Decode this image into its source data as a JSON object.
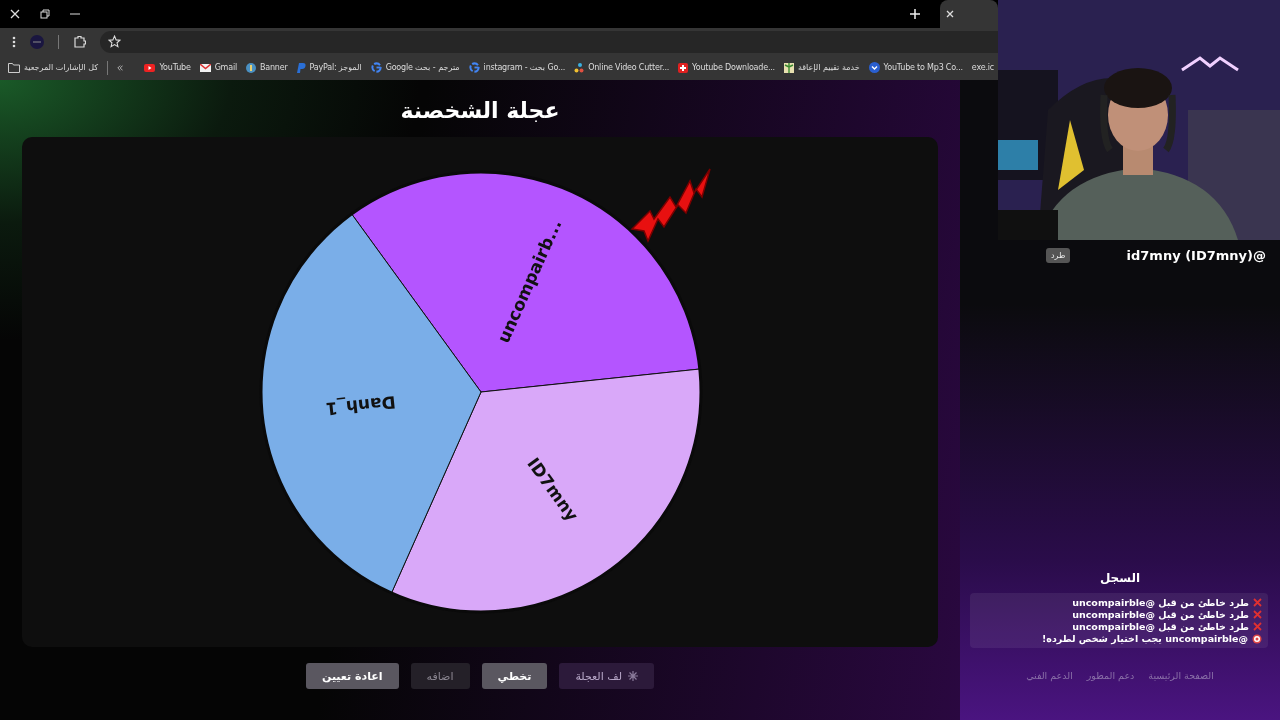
{
  "bookmarks": [
    {
      "label": "exe.ic",
      "kind": "none"
    },
    {
      "label": "YouTube to Mp3 Co...",
      "kind": "chevron"
    },
    {
      "label": "خدمة تقييم الإعاقة",
      "kind": "palm"
    },
    {
      "label": "Youtube Downloade...",
      "kind": "swiss"
    },
    {
      "label": "Online Video Cutter...",
      "kind": "dots"
    },
    {
      "label": "instagram - بحث Go...",
      "kind": "google"
    },
    {
      "label": "Google مترجم - بحث",
      "kind": "google"
    },
    {
      "label": "PayPal: الموجز",
      "kind": "paypal"
    },
    {
      "label": "Banner",
      "kind": "banner"
    },
    {
      "label": "Gmail",
      "kind": "gmail"
    },
    {
      "label": "YouTube",
      "kind": "youtube"
    },
    {
      "label": "كل الإشارات المرجعية",
      "kind": "folder"
    }
  ],
  "page": {
    "title": "عجلة الشخصنة",
    "wheel": {
      "segments": [
        {
          "label": "uncompairb...",
          "color": "#b455ff"
        },
        {
          "label": "ID7mny",
          "color": "#d9a8f9"
        },
        {
          "label": "Danh_1",
          "color": "#7aaee8"
        }
      ]
    },
    "buttons": [
      {
        "label": "لف العجلة",
        "kind": "spin",
        "disabled": true
      },
      {
        "label": "تخطي",
        "kind": "plain",
        "disabled": false
      },
      {
        "label": "اضافه",
        "kind": "plain",
        "disabled": true
      },
      {
        "label": "اعادة تعيين",
        "kind": "plain",
        "disabled": false
      }
    ]
  },
  "side": {
    "user": "id7mny (ID7mny)@",
    "kick_button": "طرد",
    "log_title": "السجل",
    "log": [
      {
        "kind": "error",
        "text": "طرد خاطئ من قبل @uncompairble"
      },
      {
        "kind": "error",
        "text": "طرد خاطئ من قبل @uncompairble"
      },
      {
        "kind": "error",
        "text": "طرد خاطئ من قبل @uncompairble"
      },
      {
        "kind": "target",
        "text": "@uncompairble يجب اختيار شخص لطرده!"
      }
    ],
    "footer_links": [
      "الصفحة الرئيسية",
      "دعم المطور",
      "الدعم الفني"
    ]
  }
}
